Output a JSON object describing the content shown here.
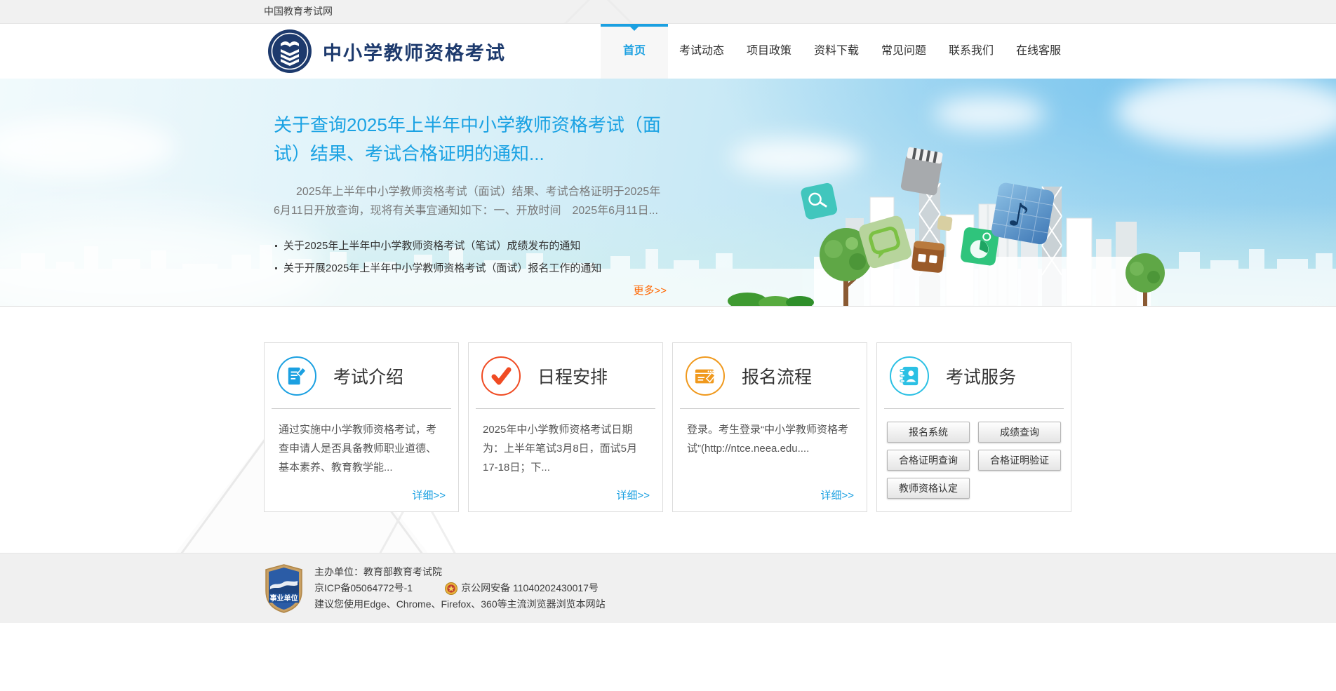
{
  "topbar": {
    "site_name": "中国教育考试网"
  },
  "header": {
    "logo_title": "中小学教师资格考试",
    "nav": [
      {
        "label": "首页",
        "active": true
      },
      {
        "label": "考试动态",
        "active": false
      },
      {
        "label": "项目政策",
        "active": false
      },
      {
        "label": "资料下载",
        "active": false
      },
      {
        "label": "常见问题",
        "active": false
      },
      {
        "label": "联系我们",
        "active": false
      },
      {
        "label": "在线客服",
        "active": false
      }
    ]
  },
  "banner": {
    "title": "关于查询2025年上半年中小学教师资格考试（面试）结果、考试合格证明的通知...",
    "summary": "2025年上半年中小学教师资格考试（面试）结果、考试合格证明于2025年6月11日开放查询，现将有关事宜通知如下：一、开放时间　2025年6月11日...",
    "news": [
      "关于2025年上半年中小学教师资格考试（笔试）成绩发布的通知",
      "关于开展2025年上半年中小学教师资格考试（面试）报名工作的通知"
    ],
    "more_label": "更多>>"
  },
  "cards": [
    {
      "title": "考试介绍",
      "icon": "exam-intro-icon",
      "accent": "#1ba0e1",
      "body": "通过实施中小学教师资格考试，考查申请人是否具备教师职业道德、基本素养、教育教学能...",
      "link_label": "详细>>"
    },
    {
      "title": "日程安排",
      "icon": "schedule-check-icon",
      "accent": "#f04b23",
      "body": "2025年中小学教师资格考试日期为：上半年笔试3月8日，面试5月17-18日；下...",
      "link_label": "详细>>"
    },
    {
      "title": "报名流程",
      "icon": "registration-form-icon",
      "accent": "#f0991d",
      "body": "登录。考生登录“中小学教师资格考试”(http://ntce.neea.edu....",
      "link_label": "详细>>"
    },
    {
      "title": "考试服务",
      "icon": "service-book-icon",
      "accent": "#2bc0e4",
      "buttons": [
        "报名系统",
        "成绩查询",
        "合格证明查询",
        "合格证明验证",
        "教师资格认定"
      ]
    }
  ],
  "footer": {
    "badge_label": "事业单位",
    "organizer": "主办单位：教育部教育考试院",
    "icp": "京ICP备05064772号-1",
    "police": "京公网安备 11040202430017号",
    "browser_tip": "建议您使用Edge、Chrome、Firefox、360等主流浏览器浏览本网站"
  },
  "colors": {
    "accent_blue": "#1ba0e1",
    "logo_navy": "#1d3a6d",
    "more_orange": "#ff6600",
    "card_red": "#f04b23",
    "card_orange": "#f0991d",
    "card_cyan": "#2bc0e4",
    "footer_bg": "#f0f0f0"
  }
}
